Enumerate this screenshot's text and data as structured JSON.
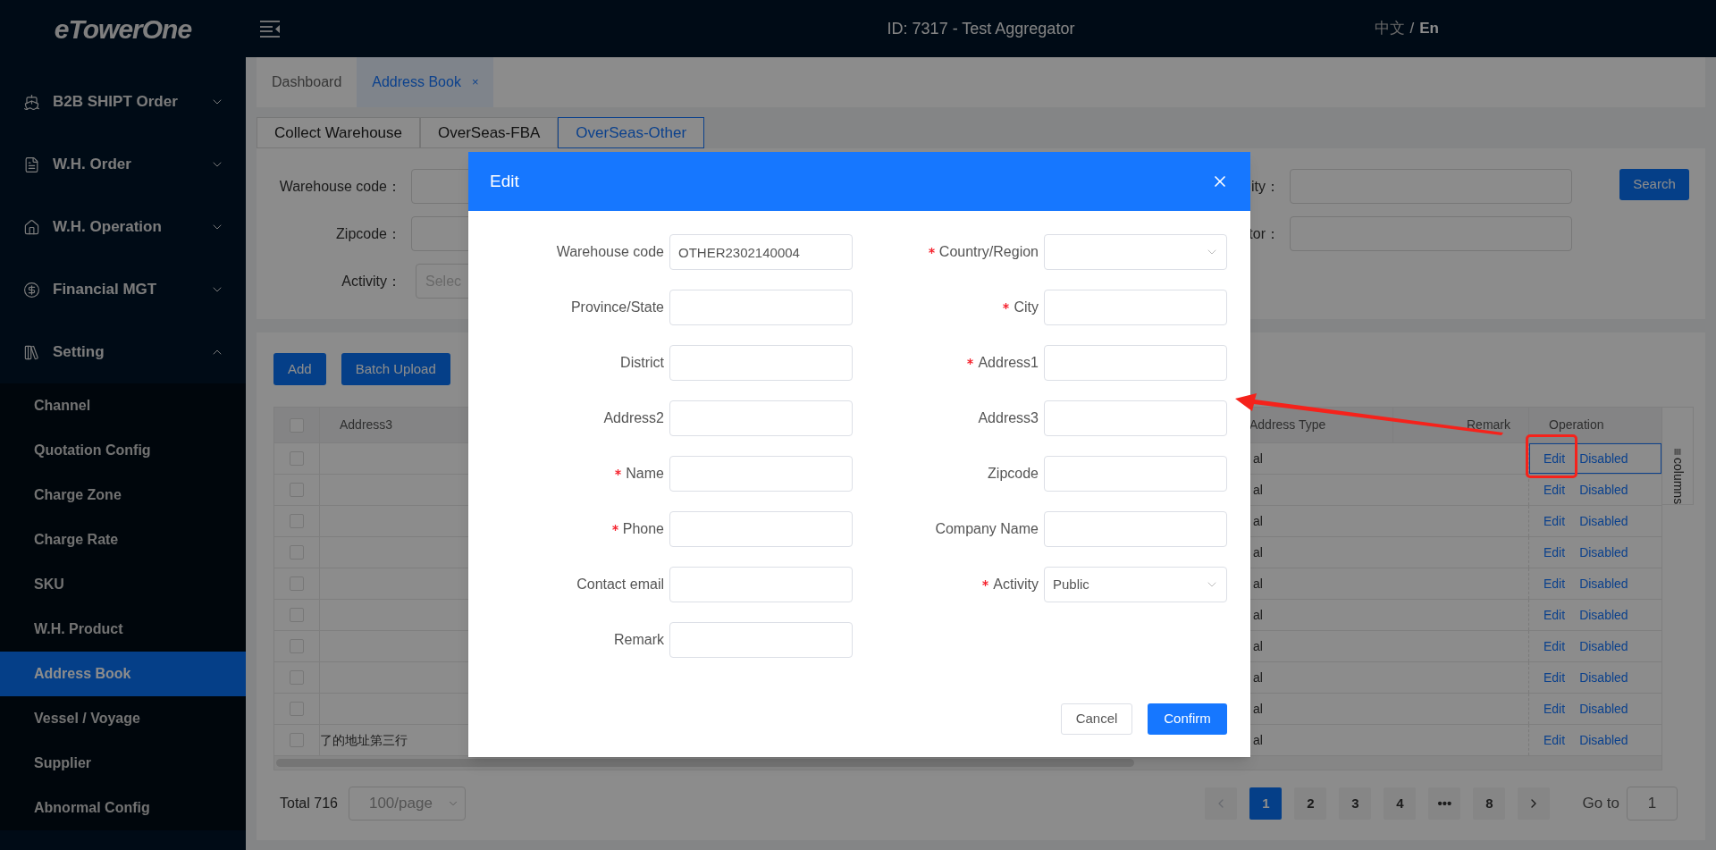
{
  "header": {
    "logo": "eTowerOne",
    "title": "ID: 7317 - Test Aggregator",
    "languages": [
      {
        "label": "中文",
        "selected": false
      },
      {
        "label": "En",
        "selected": true
      }
    ],
    "language_separator": "/"
  },
  "sidebar": {
    "items": [
      {
        "label": "B2B SHIPT Order",
        "expanded": false
      },
      {
        "label": "W.H. Order",
        "expanded": false
      },
      {
        "label": "W.H. Operation",
        "expanded": false
      },
      {
        "label": "Financial MGT",
        "expanded": false
      },
      {
        "label": "Setting",
        "expanded": true,
        "children": [
          {
            "label": "Channel",
            "selected": false
          },
          {
            "label": "Quotation Config",
            "selected": false
          },
          {
            "label": "Charge Zone",
            "selected": false
          },
          {
            "label": "Charge Rate",
            "selected": false
          },
          {
            "label": "SKU",
            "selected": false
          },
          {
            "label": "W.H. Product",
            "selected": false
          },
          {
            "label": "Address Book",
            "selected": true
          },
          {
            "label": "Vessel / Voyage",
            "selected": false
          },
          {
            "label": "Supplier",
            "selected": false
          },
          {
            "label": "Abnormal Config",
            "selected": false
          }
        ]
      }
    ]
  },
  "tabs": [
    {
      "label": "Dashboard",
      "selected": false
    },
    {
      "label": "Address Book",
      "selected": true,
      "close": "×"
    }
  ],
  "sub_tabs": [
    {
      "label": "Collect Warehouse",
      "selected": false
    },
    {
      "label": "OverSeas-FBA",
      "selected": false
    },
    {
      "label": "OverSeas-Other",
      "selected": true
    }
  ],
  "filters": {
    "left": [
      {
        "label": "Warehouse code：",
        "kind": "input"
      },
      {
        "label": "Zipcode：",
        "kind": "input"
      },
      {
        "label": "Activity：",
        "kind": "select",
        "placeholder": "Selec"
      }
    ],
    "right": [
      {
        "label": "ity：",
        "kind": "input"
      },
      {
        "label": "tor：",
        "kind": "input"
      }
    ],
    "search": "Search"
  },
  "table": {
    "buttons": [
      "Add",
      "Batch Upload"
    ],
    "header_checked": false,
    "columns": [
      "Address3",
      "Address Type",
      "Remark",
      "Operation"
    ],
    "rows": [
      {
        "checked": false,
        "focused": true,
        "address_type": "al",
        "actions": [
          "Edit",
          "Disabled"
        ]
      },
      {
        "checked": false,
        "focused": false,
        "address_type": "al",
        "actions": [
          "Edit",
          "Disabled"
        ]
      },
      {
        "checked": false,
        "focused": false,
        "address_type": "al",
        "actions": [
          "Edit",
          "Disabled"
        ]
      },
      {
        "checked": false,
        "focused": false,
        "address_type": "al",
        "actions": [
          "Edit",
          "Disabled"
        ]
      },
      {
        "checked": false,
        "focused": false,
        "address_type": "al",
        "actions": [
          "Edit",
          "Disabled"
        ]
      },
      {
        "checked": false,
        "focused": false,
        "address_type": "al",
        "actions": [
          "Edit",
          "Disabled"
        ]
      },
      {
        "checked": false,
        "focused": false,
        "address_type": "al",
        "actions": [
          "Edit",
          "Disabled"
        ]
      },
      {
        "checked": false,
        "focused": false,
        "address_type": "al",
        "actions": [
          "Edit",
          "Disabled"
        ]
      },
      {
        "checked": false,
        "focused": false,
        "address_type": "al",
        "actions": [
          "Edit",
          "Disabled"
        ]
      },
      {
        "checked": false,
        "focused": false,
        "address3": "了的地址第三行",
        "address_type": "al",
        "actions": [
          "Edit",
          "Disabled"
        ]
      }
    ],
    "columns_panel": "columns"
  },
  "pagination": {
    "total": "Total 716",
    "page_size": "100/page",
    "pages": [
      {
        "label": "1",
        "selected": true
      },
      {
        "label": "2",
        "selected": false
      },
      {
        "label": "3",
        "selected": false
      },
      {
        "label": "4",
        "selected": false
      },
      {
        "label": "•••",
        "selected": false
      },
      {
        "label": "8",
        "selected": false
      }
    ],
    "goto_label": "Go to",
    "goto_value": "1"
  },
  "modal": {
    "title": "Edit",
    "fields": [
      {
        "label": "Warehouse code",
        "required": false,
        "kind": "input",
        "value": "OTHER2302140004"
      },
      {
        "label": "Country/Region",
        "required": true,
        "kind": "select"
      },
      {
        "label": "Province/State",
        "required": false,
        "kind": "input"
      },
      {
        "label": "City",
        "required": true,
        "kind": "input"
      },
      {
        "label": "District",
        "required": false,
        "kind": "input"
      },
      {
        "label": "Address1",
        "required": true,
        "kind": "input"
      },
      {
        "label": "Address2",
        "required": false,
        "kind": "input"
      },
      {
        "label": "Address3",
        "required": false,
        "kind": "input"
      },
      {
        "label": "Name",
        "required": true,
        "kind": "input"
      },
      {
        "label": "Zipcode",
        "required": false,
        "kind": "input"
      },
      {
        "label": "Phone",
        "required": true,
        "kind": "input"
      },
      {
        "label": "Company Name",
        "required": false,
        "kind": "input"
      },
      {
        "label": "Contact email",
        "required": false,
        "kind": "input"
      },
      {
        "label": "Activity",
        "required": true,
        "kind": "select",
        "value": "Public"
      },
      {
        "label": "Remark",
        "required": false,
        "kind": "input"
      }
    ],
    "cancel": "Cancel",
    "confirm": "Confirm"
  }
}
